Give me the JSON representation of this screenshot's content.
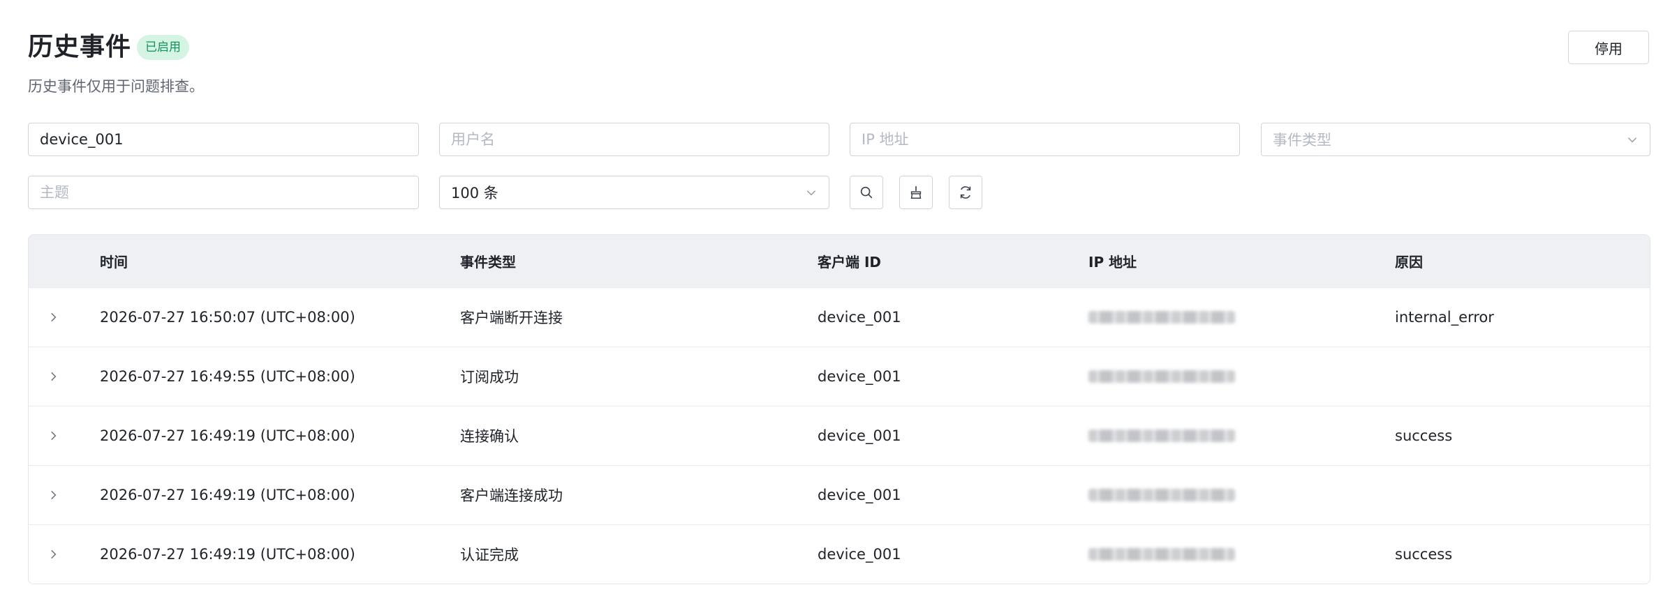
{
  "header": {
    "title": "历史事件",
    "status_badge": "已启用",
    "disable_button": "停用",
    "description": "历史事件仅用于问题排查。"
  },
  "filters": {
    "client_id": {
      "value": "device_001",
      "placeholder": ""
    },
    "username": {
      "value": "",
      "placeholder": "用户名"
    },
    "ip": {
      "value": "",
      "placeholder": "IP 地址"
    },
    "event_type": {
      "value": "",
      "placeholder": "事件类型"
    },
    "topic": {
      "value": "",
      "placeholder": "主题"
    },
    "limit": {
      "value": "100 条"
    }
  },
  "actions": {
    "search_icon": "search-icon",
    "clear_icon": "clear-icon",
    "refresh_icon": "refresh-icon"
  },
  "table": {
    "columns": [
      "时间",
      "事件类型",
      "客户端 ID",
      "IP 地址",
      "原因"
    ],
    "rows": [
      {
        "time": "2026-07-27 16:50:07 (UTC+08:00)",
        "event_type": "客户端断开连接",
        "client_id": "device_001",
        "reason": "internal_error"
      },
      {
        "time": "2026-07-27 16:49:55 (UTC+08:00)",
        "event_type": "订阅成功",
        "client_id": "device_001",
        "reason": ""
      },
      {
        "time": "2026-07-27 16:49:19 (UTC+08:00)",
        "event_type": "连接确认",
        "client_id": "device_001",
        "reason": "success"
      },
      {
        "time": "2026-07-27 16:49:19 (UTC+08:00)",
        "event_type": "客户端连接成功",
        "client_id": "device_001",
        "reason": ""
      },
      {
        "time": "2026-07-27 16:49:19 (UTC+08:00)",
        "event_type": "认证完成",
        "client_id": "device_001",
        "reason": "success"
      }
    ]
  },
  "colors": {
    "badge_bg": "#d5f4e3",
    "badge_text": "#15915a",
    "table_header_bg": "#eef0f4"
  }
}
